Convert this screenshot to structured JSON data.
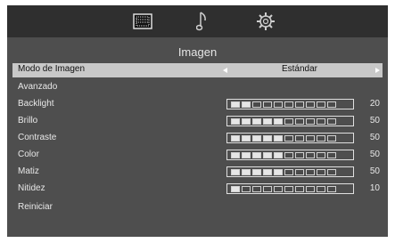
{
  "tabs": [
    {
      "name": "picture-icon"
    },
    {
      "name": "music-note-icon"
    },
    {
      "name": "gear-icon"
    }
  ],
  "menu": {
    "title": "Imagen",
    "mode": {
      "label": "Modo de Imagen",
      "value": "Estándar"
    },
    "advanced_label": "Avanzado",
    "sliders": [
      {
        "label": "Backlight",
        "value": "20",
        "level": 20
      },
      {
        "label": "Brillo",
        "value": "50",
        "level": 50
      },
      {
        "label": "Contraste",
        "value": "50",
        "level": 50
      },
      {
        "label": "Color",
        "value": "50",
        "level": 50
      },
      {
        "label": "Matiz",
        "value": "50",
        "level": 50
      },
      {
        "label": "Nitidez",
        "value": "10",
        "level": 10
      }
    ],
    "reset_label": "Reiniciar"
  },
  "colors": {
    "background": "#4e4e4e",
    "topbar": "#2f2f2f",
    "highlight": "#c8c8c8"
  }
}
